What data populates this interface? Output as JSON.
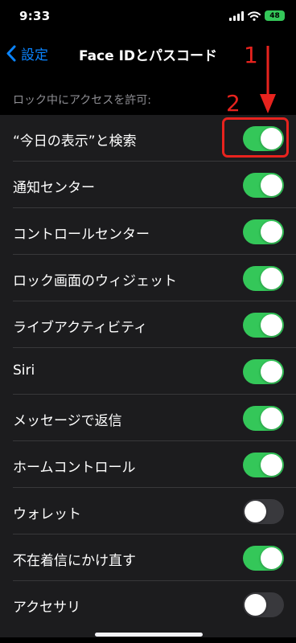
{
  "status_bar": {
    "time": "9:33",
    "battery": "48"
  },
  "nav": {
    "back_label": "設定",
    "title": "Face IDとパスコード"
  },
  "section_header": "ロック中にアクセスを許可:",
  "settings": [
    {
      "label": "“今日の表示”と検索",
      "enabled": true
    },
    {
      "label": "通知センター",
      "enabled": true
    },
    {
      "label": "コントロールセンター",
      "enabled": true
    },
    {
      "label": "ロック画面のウィジェット",
      "enabled": true
    },
    {
      "label": "ライブアクティビティ",
      "enabled": true
    },
    {
      "label": "Siri",
      "enabled": true
    },
    {
      "label": "メッセージで返信",
      "enabled": true
    },
    {
      "label": "ホームコントロール",
      "enabled": true
    },
    {
      "label": "ウォレット",
      "enabled": false
    },
    {
      "label": "不在着信にかけ直す",
      "enabled": true
    },
    {
      "label": "アクセサリ",
      "enabled": false
    }
  ],
  "annotations": {
    "step1": "1",
    "step2": "2",
    "color": "#e8231e"
  },
  "colors": {
    "accent": "#0a84ff",
    "toggle_on": "#34c759",
    "toggle_off": "#39393d"
  }
}
